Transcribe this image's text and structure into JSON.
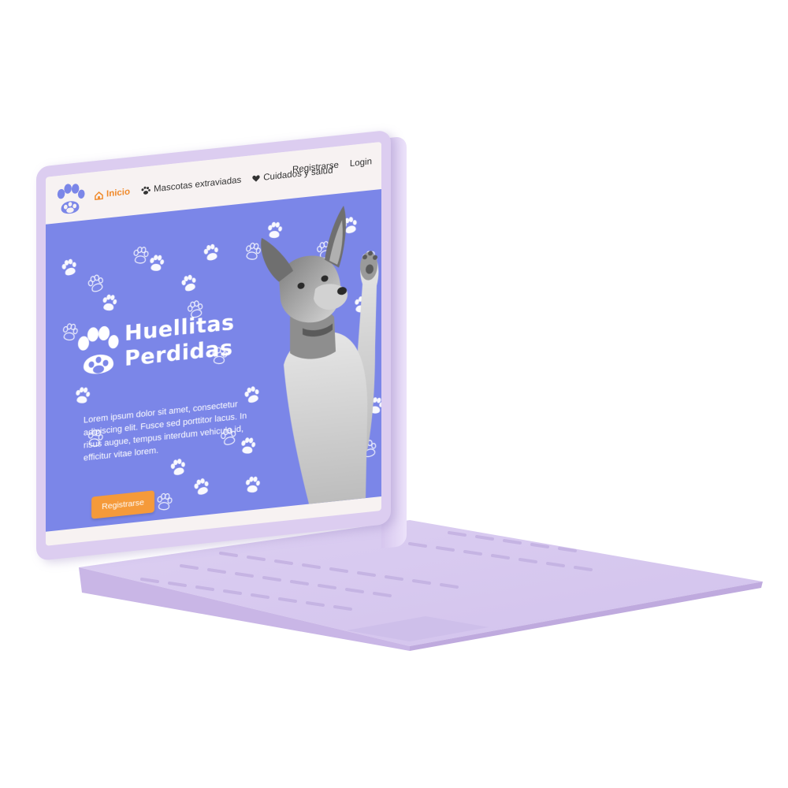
{
  "nav": {
    "items": [
      {
        "label": "Inicio",
        "icon": "home-icon",
        "active": true
      },
      {
        "label": "Mascotas extraviadas",
        "icon": "paw-icon",
        "active": false
      },
      {
        "label": "Cuidados y salud",
        "icon": "heart-icon",
        "active": false
      }
    ],
    "register_label": "Registrarse",
    "login_label": "Login"
  },
  "hero": {
    "title_line1": "Huellitas",
    "title_line2": "Perdidas",
    "description": "Lorem ipsum dolor sit amet, consectetur adipiscing elit. Fusce sed porttitor lacus. In risus augue, tempus interdum vehicula id, efficitur vitae lorem.",
    "cta_label": "Registrarse"
  },
  "colors": {
    "hero_bg": "#7b86e8",
    "accent": "#f08a2b",
    "cta_bg": "#f59a3a",
    "laptop": "#dccdf0",
    "nav_bg": "#f7f2f2"
  }
}
